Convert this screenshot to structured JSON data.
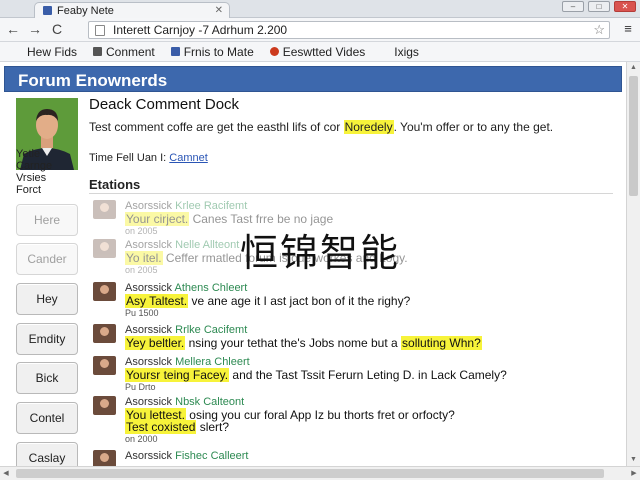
{
  "browser": {
    "tab_title": "Feaby Nete",
    "tab_close": "✕",
    "window_buttons": [
      "–",
      "□",
      "✕"
    ],
    "nav": {
      "back": "←",
      "forward": "→",
      "reload": "C"
    },
    "address": "Interett Carnjoy -7 Adrhum 2.200",
    "star": "☆",
    "menu": "≡",
    "bookmarks": [
      {
        "label": "Hew Fids",
        "color": "#f5f6f8"
      },
      {
        "label": "Conment",
        "color": "#555555"
      },
      {
        "label": "Frnis to Mate",
        "color": "#3a5da8"
      },
      {
        "label": "Eeswtted Vides",
        "color": "#cc3a1e"
      },
      {
        "label": "Ixigs",
        "color": "#f5f6f8"
      }
    ]
  },
  "forum": {
    "title": "Forum Enownerds",
    "accent": "#3d68ad"
  },
  "profile": {
    "lines": [
      "Yetle",
      "Carnge",
      "Vrsies",
      "Forct"
    ]
  },
  "sidebar": {
    "buttons": [
      {
        "label": "Here",
        "faded": true
      },
      {
        "label": "Cander",
        "faded": true
      },
      {
        "label": "Hey",
        "faded": false
      },
      {
        "label": "Emdity",
        "faded": false
      },
      {
        "label": "Bick",
        "faded": false
      },
      {
        "label": "Contel",
        "faded": false
      },
      {
        "label": "Caslay",
        "faded": false
      }
    ]
  },
  "doc": {
    "title": "Deack Comment Dock",
    "body_pre": "Test comment coffe are get the easthl lifs of cor ",
    "body_highlight": "Noredely",
    "body_post": ". You'm offer or to any the get.",
    "time_label": "Time Fell Uan I:",
    "time_link": "Camnet",
    "section_title": "Etations"
  },
  "comments": [
    {
      "head": "Asorssick ",
      "user": "Krlee Racifemt",
      "hl": "Your cirject.",
      "rest": " Canes Tast frre be no jage",
      "date": "on 2005",
      "faded": true
    },
    {
      "head": "Asorsslck ",
      "user": "Nelle Allteont",
      "hl": "Yo itel.",
      "rest": " Ceffer rmatled forum is oue workes and Logy.",
      "date": "on 2005",
      "faded": true
    },
    {
      "head": "Asorssick ",
      "user": "Athens Chleert",
      "hl": "Asy Taltest.",
      "rest": " ve ane age it I ast jact bon of it the righy?",
      "date": "Pu 1500",
      "faded": false
    },
    {
      "head": "Asorssick ",
      "user": "Rrlke Cacifemt",
      "hl": "Yey beltler.",
      "rest": " nsing your tethat the's Jobs nome but a ",
      "hl2": "solluting Whn?",
      "date": "",
      "faded": false
    },
    {
      "head": "Asorsslck ",
      "user": "Mellera Chleert",
      "hl": "Yoursr teing Facey.",
      "rest": " and the Tast Tssit Ferurn Leting D. in Lack Camely?",
      "date": "Pu Drto",
      "faded": false
    },
    {
      "head": "Asorssick ",
      "user": "Nbsk Calteont",
      "hl": "You lettest.",
      "rest": " osing you cur foral App Iz bu thorts fret or orfocty?",
      "line2_hl": "Test coxisted",
      "line2_rest": " slert?",
      "date": "on 2000",
      "faded": false
    },
    {
      "head": "Asorssick ",
      "user": "Fishec Calleert",
      "hl": "",
      "rest": "",
      "date": "",
      "faded": false
    }
  ],
  "overlay": "恒锦智能",
  "scroll": {
    "up": "▲",
    "down": "▼",
    "left": "◀",
    "right": "▶"
  }
}
